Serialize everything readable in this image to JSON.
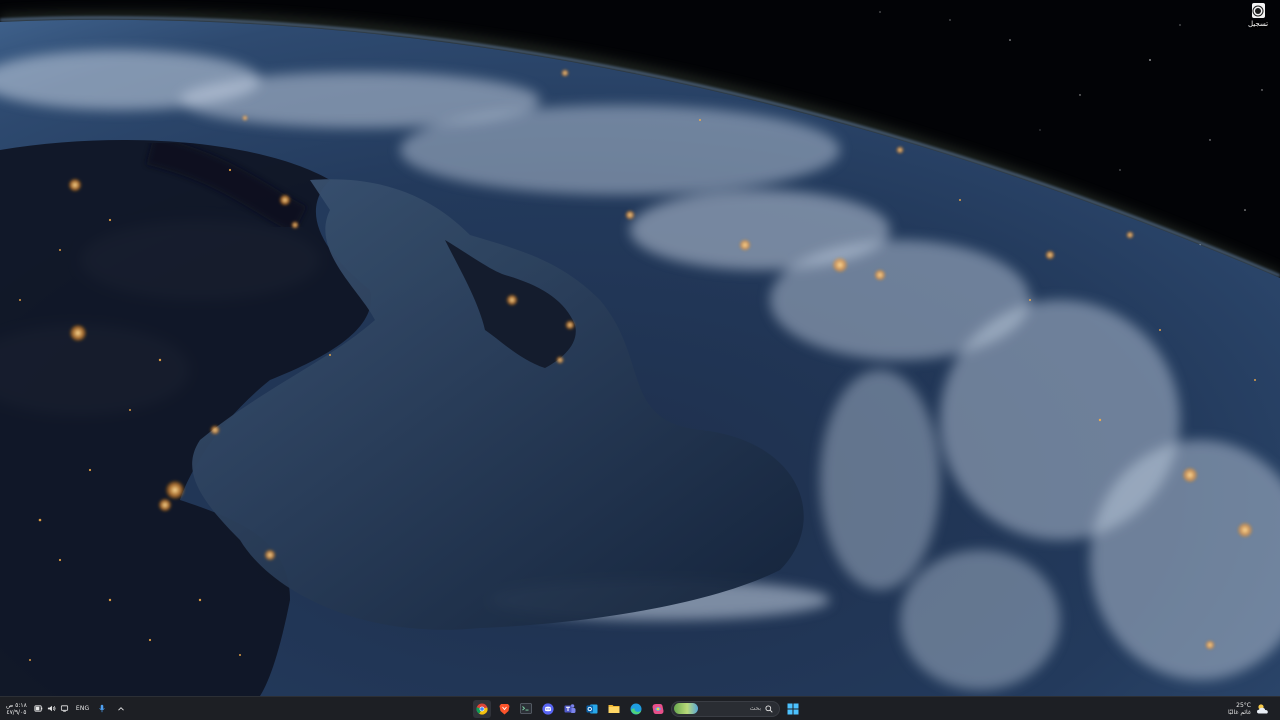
{
  "desktop": {
    "icons": [
      {
        "label": "تسجيل",
        "icon": "record-app-icon"
      }
    ]
  },
  "taskbar": {
    "clock": {
      "time": "٥:١٨ ص",
      "date": "٤٧/٩/٠٥"
    },
    "tray": {
      "language": "ENG",
      "icons": [
        "chevron-up-icon",
        "microphone-icon",
        "network-icon",
        "volume-icon",
        "battery-icon"
      ]
    },
    "search": {
      "placeholder": "بحث"
    },
    "pinned_apps": [
      "windows-start-icon",
      "search-icon",
      "file-explorer-icon",
      "edge-icon",
      "copilot-icon",
      "outlook-icon",
      "teams-icon",
      "discord-icon",
      "terminal-icon",
      "brave-icon",
      "chrome-icon"
    ],
    "weather": {
      "temperature": "25°C",
      "condition": "غائم غالبًا"
    }
  },
  "colors": {
    "taskbar_bg": "#1d1f24",
    "ocean": "#1b2a44",
    "city_lights": "#ffb347"
  }
}
